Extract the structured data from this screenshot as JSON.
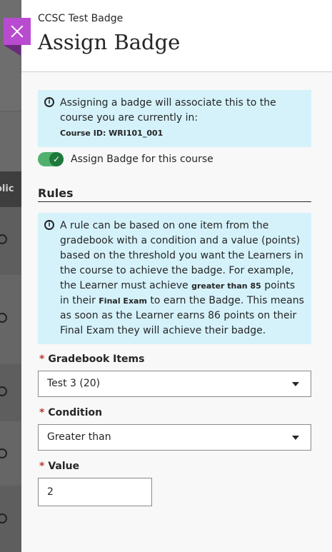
{
  "background": {
    "tab_text": "olic"
  },
  "header": {
    "subtitle": "CCSC Test Badge",
    "title": "Assign Badge"
  },
  "course_info": {
    "message": "Assigning a badge will associate this to the course you are currently in:",
    "course_id": "Course ID: WRI101_001"
  },
  "toggle": {
    "label": "Assign Badge for this course",
    "on": true
  },
  "rules": {
    "title": "Rules",
    "info_part1": "A rule can be based on one item from the gradebook with a condition and a value (points) based on the threshold you want the Learners in the course to achieve the badge. For example, the Learner must achieve ",
    "info_bold1": "greater than 85",
    "info_part2": " points in their ",
    "info_bold2": "Final Exam",
    "info_part3": " to earn the Badge. This means as soon as the Learner earns 86 points on their Final Exam they will achieve their badge."
  },
  "form": {
    "required_mark": "*",
    "gradebook_label": "Gradebook Items",
    "gradebook_value": "Test 3 (20)",
    "condition_label": "Condition",
    "condition_value": "Greater than",
    "value_label": "Value",
    "value_value": "2"
  },
  "colors": {
    "accent": "#b94bd0",
    "info_bg": "#d5f2fb",
    "toggle_on": "#52b06f",
    "required": "#c0392b"
  }
}
